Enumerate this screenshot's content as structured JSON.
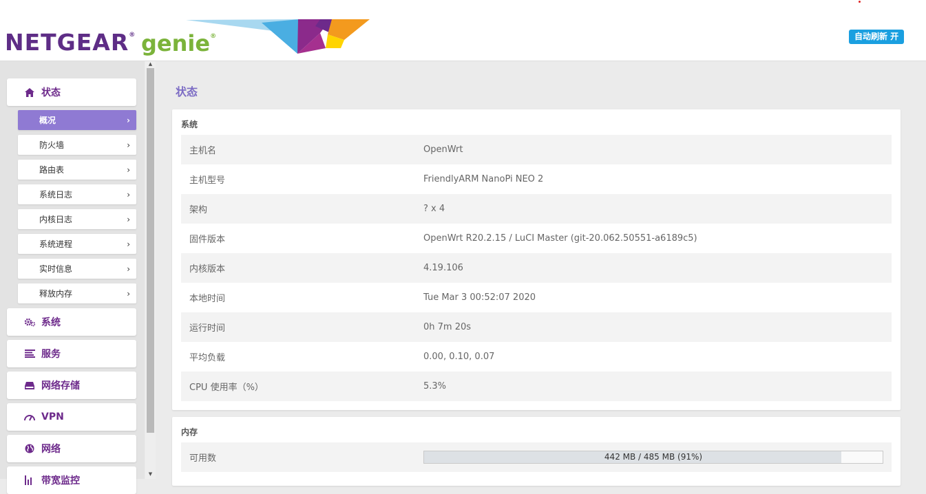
{
  "header": {
    "brand_netgear": "NETGEAR",
    "brand_genie": "genie",
    "registered_mark": "®",
    "auto_refresh_label": "自动刷新 开",
    "colors": {
      "brand_purple": "#5e2d86",
      "brand_green": "#7bb33a",
      "refresh_blue": "#1a9fe0"
    }
  },
  "sidebar": {
    "status": {
      "label": "状态",
      "icon": "home-icon"
    },
    "sub_items": [
      {
        "label": "概况",
        "active": true
      },
      {
        "label": "防火墙",
        "active": false
      },
      {
        "label": "路由表",
        "active": false
      },
      {
        "label": "系统日志",
        "active": false
      },
      {
        "label": "内核日志",
        "active": false
      },
      {
        "label": "系统进程",
        "active": false
      },
      {
        "label": "实时信息",
        "active": false
      },
      {
        "label": "释放内存",
        "active": false
      }
    ],
    "chevron": "›",
    "main_items": [
      {
        "label": "系统",
        "icon": "gears-icon"
      },
      {
        "label": "服务",
        "icon": "list-icon"
      },
      {
        "label": "网络存储",
        "icon": "drive-icon"
      },
      {
        "label": "VPN",
        "icon": "gauge-icon"
      },
      {
        "label": "网络",
        "icon": "globe-icon"
      },
      {
        "label": "带宽监控",
        "icon": "chart-icon"
      }
    ],
    "active_color": "#8f7ad3"
  },
  "main": {
    "page_title": "状态",
    "system": {
      "title": "系统",
      "rows": [
        {
          "key": "主机名",
          "value": "OpenWrt"
        },
        {
          "key": "主机型号",
          "value": "FriendlyARM NanoPi NEO 2"
        },
        {
          "key": "架构",
          "value": "? x 4"
        },
        {
          "key": "固件版本",
          "value": "OpenWrt R20.2.15 / LuCI Master (git-20.062.50551-a6189c5)"
        },
        {
          "key": "内核版本",
          "value": "4.19.106"
        },
        {
          "key": "本地时间",
          "value": "Tue Mar 3 00:52:07 2020"
        },
        {
          "key": "运行时间",
          "value": "0h 7m 20s"
        },
        {
          "key": "平均负载",
          "value": "0.00, 0.10, 0.07"
        },
        {
          "key": "CPU 使用率（%）",
          "value": "5.3%"
        }
      ]
    },
    "memory": {
      "title": "内存",
      "available": {
        "key": "可用数",
        "text": "442 MB / 485 MB (91%)",
        "fraction": 0.91
      }
    }
  }
}
